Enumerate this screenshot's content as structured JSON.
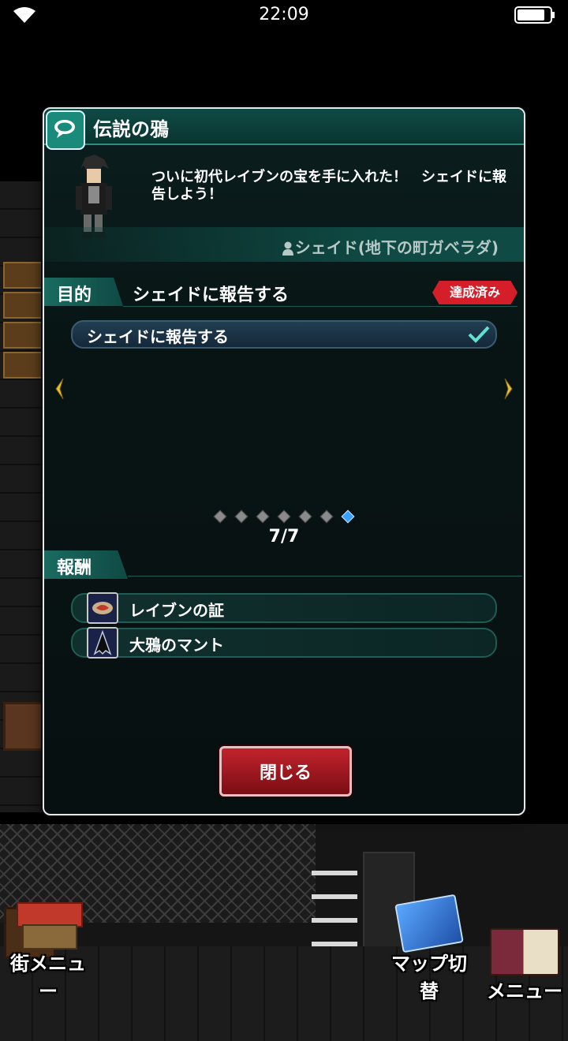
{
  "status_bar": {
    "time": "22:09"
  },
  "dialog": {
    "title": "伝説の鴉",
    "message": "ついに初代レイブンの宝を手に入れた！　シェイドに報告しよう！",
    "npc": "シェイド(地下の町ガベラダ)",
    "objective": {
      "label": "目的",
      "title": "シェイドに報告する",
      "status_badge": "達成済み",
      "items": [
        {
          "label": "シェイドに報告する",
          "completed": true
        }
      ]
    },
    "pagination": {
      "current": 7,
      "total": 7,
      "text": "7/7"
    },
    "rewards": {
      "label": "報酬",
      "items": [
        {
          "label": "レイブンの証",
          "icon": "emblem-icon"
        },
        {
          "label": "大鴉のマント",
          "icon": "cloak-icon"
        }
      ]
    },
    "close_label": "閉じる"
  },
  "hud": {
    "town_menu": "街メニュー",
    "map_switch": "マップ切替",
    "menu": "メニュー"
  },
  "colors": {
    "accent": "#0f4a44",
    "badge": "#d41f2a",
    "close_button": "#a31a22"
  }
}
